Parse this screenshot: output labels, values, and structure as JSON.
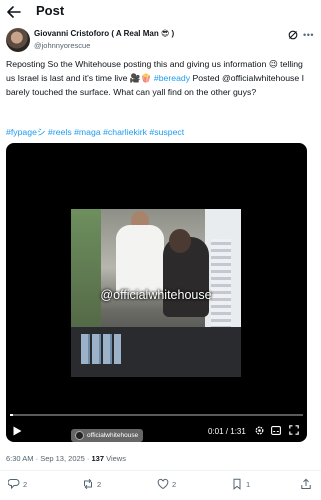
{
  "header": {
    "title": "Post"
  },
  "author": {
    "name": "Giovanni Cristoforo ( A Real Man 😎 )",
    "handle": "@johnnyorescue"
  },
  "post": {
    "text_1": "Reposting So the Whitehouse posting this and giving us information 😉 telling us Israel is last and it's time live 🎥🍿 ",
    "link_bereadY": "#beready",
    "text_2": " Posted @officialwhitehouse I barely touched the surface. What can yall find on the other guys?",
    "hashtags": "#fypageシ #reels #maga #charliekirk #suspect"
  },
  "video": {
    "watermark": "@officialwhitehouse",
    "current_time": "0:01",
    "duration": "1:31",
    "time_separator": " / ",
    "progress_fraction": 0.011,
    "source_badge": "officialwhitehouse"
  },
  "meta": {
    "time": "6:30 AM",
    "sep1": " · ",
    "date": "Sep 13, 2025",
    "sep2": " · ",
    "views_count": "137",
    "views_label": " Views"
  },
  "actions": {
    "replies": "2",
    "reposts": "2",
    "likes": "2",
    "bookmarks": "1"
  },
  "colors": {
    "link": "#1d9bf0",
    "muted": "#536471",
    "text": "#0f1419"
  },
  "icons": [
    "back-arrow-icon",
    "grok-icon",
    "more-icon",
    "play-icon",
    "settings-icon",
    "captions-icon",
    "fullscreen-icon",
    "reply-icon",
    "repost-icon",
    "like-icon",
    "bookmark-icon"
  ]
}
